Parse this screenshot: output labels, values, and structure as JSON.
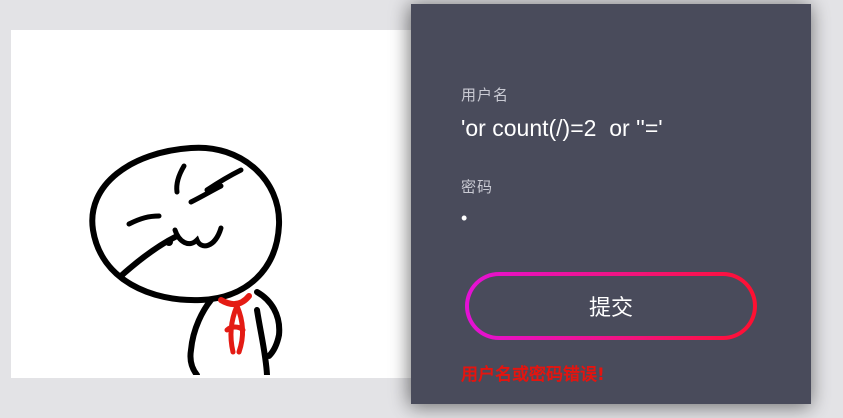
{
  "login": {
    "username_label": "用户名",
    "username_value": "'or count(/)=2  or ''='",
    "password_label": "密码",
    "password_value": "•",
    "submit_label": "提交",
    "error_message": "用户名或密码错误!"
  },
  "colors": {
    "page_background": "#e3e3e6",
    "panel_background": "#494b5b",
    "label_text": "#c9cad3",
    "input_text": "#ffffff",
    "button_gradient_start": "#e411d6",
    "button_gradient_end": "#ff1030",
    "error_text": "#e5140f"
  },
  "image": {
    "description": "stick-figure-meme"
  }
}
